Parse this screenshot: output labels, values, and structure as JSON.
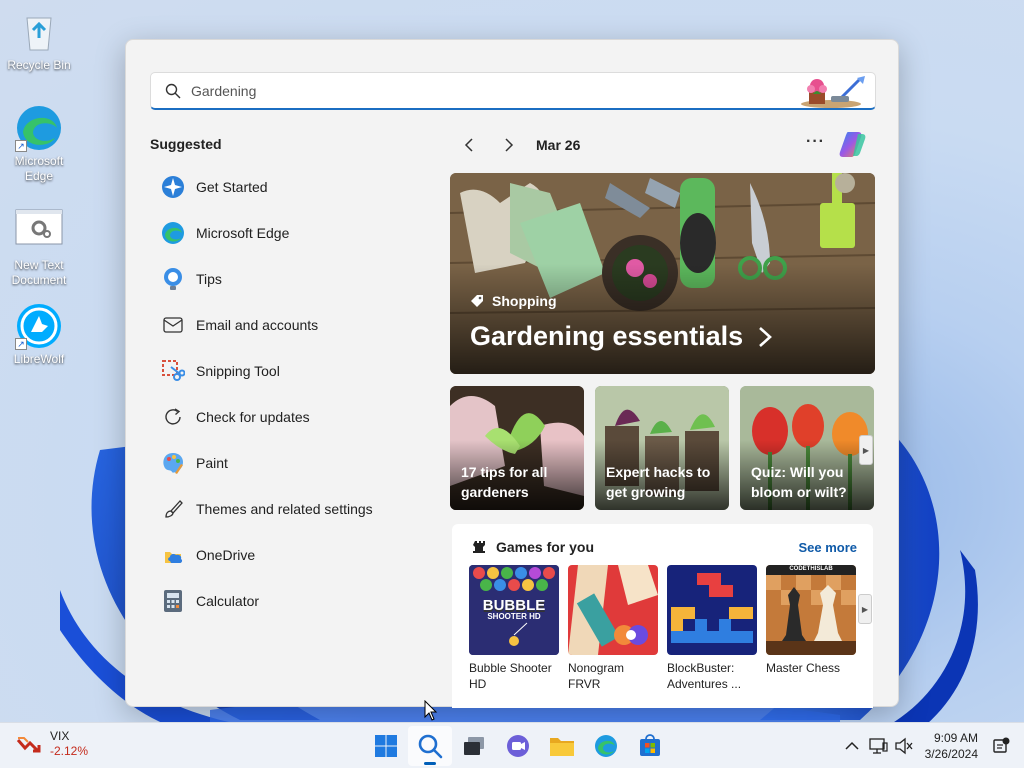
{
  "desktop": {
    "icons": [
      {
        "label": "Recycle Bin"
      },
      {
        "label": "Microsoft Edge"
      },
      {
        "label": "New Text Document"
      },
      {
        "label": "LibreWolf"
      }
    ]
  },
  "search": {
    "value": "Gardening",
    "placeholder": ""
  },
  "suggested": {
    "title": "Suggested",
    "items": [
      {
        "label": "Get Started",
        "icon": "get-started-icon"
      },
      {
        "label": "Microsoft Edge",
        "icon": "edge-icon"
      },
      {
        "label": "Tips",
        "icon": "tips-icon"
      },
      {
        "label": "Email and accounts",
        "icon": "mail-icon"
      },
      {
        "label": "Snipping Tool",
        "icon": "snipping-tool-icon"
      },
      {
        "label": "Check for updates",
        "icon": "refresh-icon"
      },
      {
        "label": "Paint",
        "icon": "paint-icon"
      },
      {
        "label": "Themes and related settings",
        "icon": "brush-icon"
      },
      {
        "label": "OneDrive",
        "icon": "onedrive-icon"
      },
      {
        "label": "Calculator",
        "icon": "calculator-icon"
      }
    ]
  },
  "feed": {
    "date": "Mar 26",
    "more": "···",
    "hero": {
      "tag": "Shopping",
      "headline": "Gardening essentials"
    },
    "cards": [
      {
        "text": "17 tips for all gardeners"
      },
      {
        "text": "Expert hacks to get growing"
      },
      {
        "text": "Quiz: Will you bloom or wilt?"
      }
    ],
    "games": {
      "title": "Games for you",
      "see_more": "See more",
      "items": [
        {
          "name": "Bubble Shooter HD",
          "logo_text": "BUBBLE",
          "logo_sub": "SHOOTER HD"
        },
        {
          "name": "Nonogram FRVR"
        },
        {
          "name": "BlockBuster: Adventures ..."
        },
        {
          "name": "Master Chess",
          "logo_text": "CODETHISLAB"
        }
      ]
    }
  },
  "taskbar": {
    "widget": {
      "name": "VIX",
      "change": "-2.12%"
    },
    "time": "9:09 AM",
    "date": "3/26/2024"
  },
  "colors": {
    "accent": "#005fb8",
    "negative": "#c42b1c",
    "link": "#0f5aa8"
  }
}
